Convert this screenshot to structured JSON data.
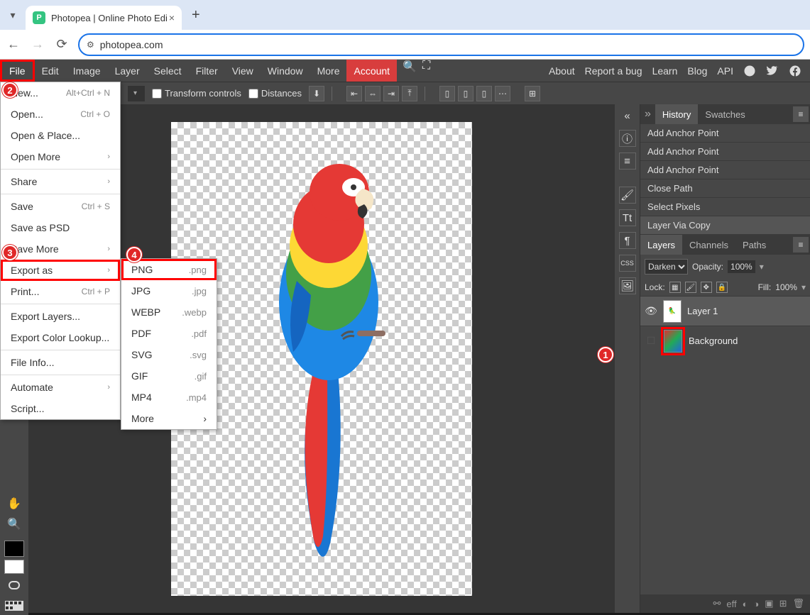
{
  "browser": {
    "tab_title": "Photopea | Online Photo Edi",
    "url": "photopea.com"
  },
  "menubar": {
    "items": [
      "File",
      "Edit",
      "Image",
      "Layer",
      "Select",
      "Filter",
      "View",
      "Window",
      "More"
    ],
    "account": "Account",
    "right_links": [
      "About",
      "Report a bug",
      "Learn",
      "Blog",
      "API"
    ]
  },
  "options_bar": {
    "transform_controls": "Transform controls",
    "distances": "Distances"
  },
  "file_menu": [
    {
      "label": "New...",
      "shortcut": "Alt+Ctrl + N"
    },
    {
      "label": "Open...",
      "shortcut": "Ctrl + O"
    },
    {
      "label": "Open & Place..."
    },
    {
      "label": "Open More",
      "submenu": true
    },
    {
      "sep": true
    },
    {
      "label": "Share",
      "submenu": true
    },
    {
      "sep": true
    },
    {
      "label": "Save",
      "shortcut": "Ctrl + S"
    },
    {
      "label": "Save as PSD"
    },
    {
      "label": "Save More",
      "submenu": true
    },
    {
      "label": "Export as",
      "submenu": true,
      "highlight": true
    },
    {
      "label": "Print...",
      "shortcut": "Ctrl + P"
    },
    {
      "sep": true
    },
    {
      "label": "Export Layers..."
    },
    {
      "label": "Export Color Lookup..."
    },
    {
      "sep": true
    },
    {
      "label": "File Info..."
    },
    {
      "sep": true
    },
    {
      "label": "Automate",
      "submenu": true
    },
    {
      "label": "Script..."
    }
  ],
  "export_menu": [
    {
      "label": "PNG",
      "ext": ".png",
      "highlight": true
    },
    {
      "label": "JPG",
      "ext": ".jpg"
    },
    {
      "label": "WEBP",
      "ext": ".webp"
    },
    {
      "label": "PDF",
      "ext": ".pdf"
    },
    {
      "label": "SVG",
      "ext": ".svg"
    },
    {
      "label": "GIF",
      "ext": ".gif"
    },
    {
      "label": "MP4",
      "ext": ".mp4"
    },
    {
      "label": "More",
      "submenu": true
    }
  ],
  "history": {
    "tab": "History",
    "swatches_tab": "Swatches",
    "items": [
      "Add Anchor Point",
      "Add Anchor Point",
      "Add Anchor Point",
      "Close Path",
      "Select Pixels",
      "Layer Via Copy"
    ]
  },
  "layers_panel": {
    "tabs": [
      "Layers",
      "Channels",
      "Paths"
    ],
    "blend_mode": "Darken",
    "opacity_label": "Opacity:",
    "opacity_val": "100%",
    "lock_label": "Lock:",
    "fill_label": "Fill:",
    "fill_val": "100%",
    "layers": [
      {
        "name": "Layer 1",
        "visible": true,
        "active": true
      },
      {
        "name": "Background",
        "visible": false,
        "highlight_thumb": true
      }
    ]
  },
  "rail_labels": {
    "info": "i",
    "align": "≡",
    "brush": "brush",
    "tt": "Tt",
    "para": "¶",
    "css": "CSS",
    "img": "img"
  },
  "badges": {
    "b1": "1",
    "b2": "2",
    "b3": "3",
    "b4": "4"
  }
}
